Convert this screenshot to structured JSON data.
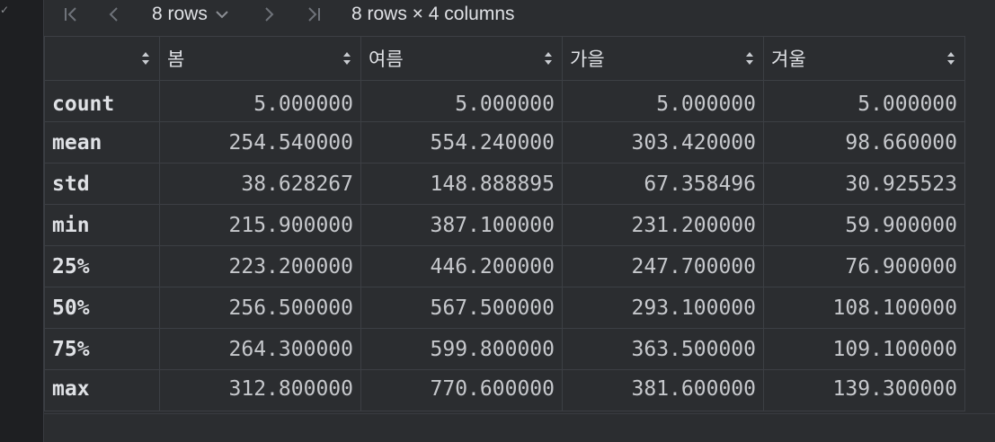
{
  "toolbar": {
    "first_icon": "first-page-icon",
    "prev_icon": "previous-page-icon",
    "rows_label": "8 rows",
    "rows_dropdown_icon": "chevron-down-icon",
    "next_icon": "next-page-icon",
    "last_icon": "last-page-icon",
    "summary": "8 rows × 4 columns"
  },
  "table": {
    "index_header": "",
    "columns": [
      {
        "label": "봄"
      },
      {
        "label": "여름"
      },
      {
        "label": "가을"
      },
      {
        "label": "겨울"
      }
    ],
    "rows": [
      {
        "label": "count",
        "values": [
          "5.000000",
          "5.000000",
          "5.000000",
          "5.000000"
        ]
      },
      {
        "label": "mean",
        "values": [
          "254.540000",
          "554.240000",
          "303.420000",
          "98.660000"
        ]
      },
      {
        "label": "std",
        "values": [
          "38.628267",
          "148.888895",
          "67.358496",
          "30.925523"
        ]
      },
      {
        "label": "min",
        "values": [
          "215.900000",
          "387.100000",
          "231.200000",
          "59.900000"
        ]
      },
      {
        "label": "25%",
        "values": [
          "223.200000",
          "446.200000",
          "247.700000",
          "76.900000"
        ]
      },
      {
        "label": "50%",
        "values": [
          "256.500000",
          "567.500000",
          "293.100000",
          "108.100000"
        ]
      },
      {
        "label": "75%",
        "values": [
          "264.300000",
          "599.800000",
          "363.500000",
          "109.100000"
        ]
      },
      {
        "label": "max",
        "values": [
          "312.800000",
          "770.600000",
          "381.600000",
          "139.300000"
        ]
      }
    ]
  },
  "colors": {
    "panel_bg": "#2b2d30",
    "grid_line": "#3c3f44",
    "text": "#dfe1e5",
    "muted_icon": "#6f737a"
  }
}
